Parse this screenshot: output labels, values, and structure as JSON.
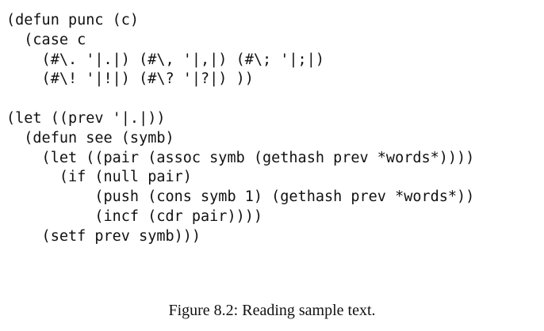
{
  "code": {
    "lines": [
      "(defun punc (c)",
      "  (case c",
      "    (#\\. '|.|) (#\\, '|,|) (#\\; '|;|)",
      "    (#\\! '|!|) (#\\? '|?|) ))",
      "",
      "(let ((prev '|.|))",
      "  (defun see (symb)",
      "    (let ((pair (assoc symb (gethash prev *words*))))",
      "      (if (null pair)",
      "          (push (cons symb 1) (gethash prev *words*))",
      "          (incf (cdr pair))))",
      "    (setf prev symb)))"
    ]
  },
  "caption": "Figure 8.2: Reading sample text."
}
